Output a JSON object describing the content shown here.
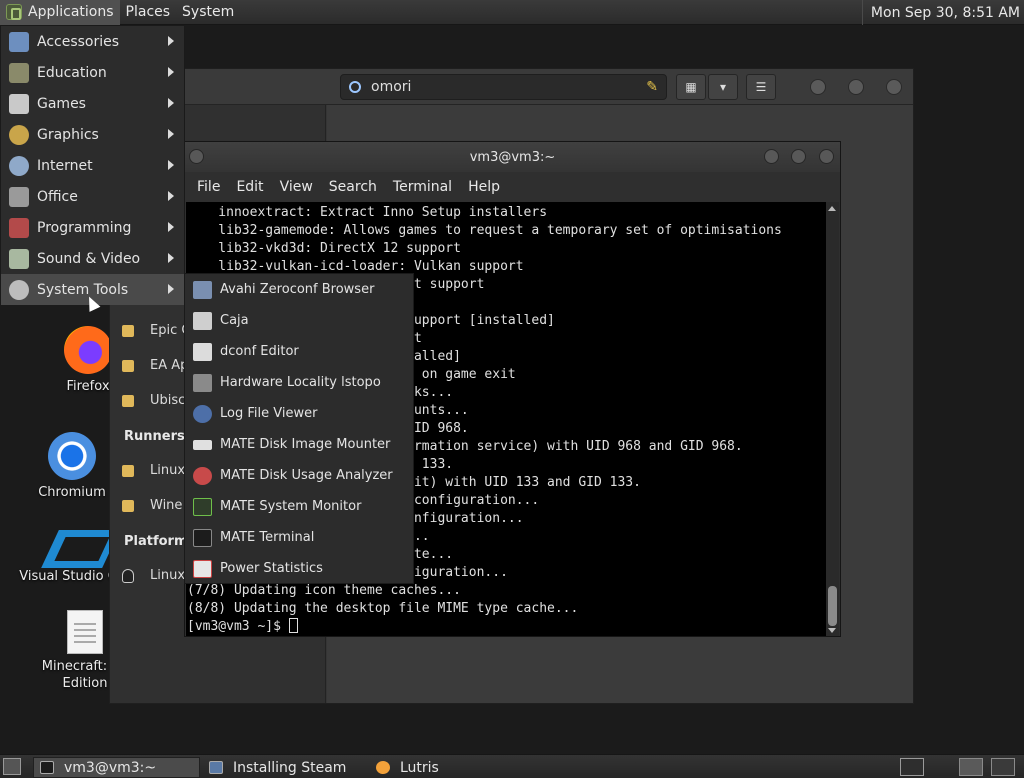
{
  "top_panel": {
    "menus": [
      "Applications",
      "Places",
      "System"
    ],
    "clock": "Mon Sep 30,  8:51 AM"
  },
  "desktop_icons": [
    {
      "label": "Firefox",
      "icon": "firefox-icon"
    },
    {
      "label": "Chromium",
      "icon": "chromium-icon"
    },
    {
      "label": "Visual Studio Co",
      "icon": "vscode-icon"
    },
    {
      "label": "Minecraft: Be",
      "label2": "Edition",
      "icon": "document-icon"
    }
  ],
  "app_menu": {
    "items": [
      {
        "label": "Accessories",
        "icon": "accessories-icon"
      },
      {
        "label": "Education",
        "icon": "education-icon"
      },
      {
        "label": "Games",
        "icon": "games-icon"
      },
      {
        "label": "Graphics",
        "icon": "graphics-icon"
      },
      {
        "label": "Internet",
        "icon": "internet-icon"
      },
      {
        "label": "Office",
        "icon": "office-icon"
      },
      {
        "label": "Programming",
        "icon": "programming-icon"
      },
      {
        "label": "Sound & Video",
        "icon": "sound-video-icon"
      },
      {
        "label": "System Tools",
        "icon": "system-tools-icon"
      }
    ],
    "active_index": 8
  },
  "system_tools_submenu": {
    "items": [
      {
        "label": "Avahi Zeroconf Browser",
        "icon": "avahi-icon"
      },
      {
        "label": "Caja",
        "icon": "caja-icon"
      },
      {
        "label": "dconf Editor",
        "icon": "dconf-icon"
      },
      {
        "label": "Hardware Locality lstopo",
        "icon": "lstopo-icon"
      },
      {
        "label": "Log File Viewer",
        "icon": "log-viewer-icon"
      },
      {
        "label": "MATE Disk Image Mounter",
        "icon": "disk-mounter-icon"
      },
      {
        "label": "MATE Disk Usage Analyzer",
        "icon": "disk-usage-icon"
      },
      {
        "label": "MATE System Monitor",
        "icon": "system-monitor-icon"
      },
      {
        "label": "MATE Terminal",
        "icon": "terminal-icon"
      },
      {
        "label": "Power Statistics",
        "icon": "power-stats-icon"
      }
    ]
  },
  "lutris": {
    "search_value": "omori",
    "library_rows": [
      {
        "label": "Epic G"
      },
      {
        "label": "EA Ap"
      },
      {
        "label": "Ubisc"
      }
    ],
    "runners_heading": "Runners",
    "runner_rows": [
      {
        "label": "Linux"
      },
      {
        "label": "Wine"
      }
    ],
    "platforms_heading": "Platforms",
    "platform_rows": [
      {
        "label": "Linux"
      }
    ]
  },
  "terminal": {
    "title": "vm3@vm3:~",
    "menu": [
      "File",
      "Edit",
      "View",
      "Search",
      "Terminal",
      "Help"
    ],
    "lines": [
      "    innoextract: Extract Inno Setup installers",
      "    lib32-gamemode: Allows games to request a temporary set of optimisations",
      "    lib32-vkd3d: DirectX 12 support",
      "    lib32-vulkan-icd-loader: Vulkan support",
      "                           net support",
      "                        :",
      "                          n support [installed]",
      "                          port",
      "                          nstalled]",
      "                           na on game exit",
      "                          hooks...",
      "                          ccounts...",
      "                          n GID 968.",
      "                          nformation service) with UID 968 and GID 968.",
      "                          GID 133.",
      "                          meKit) with UID 133 and GID 133.",
      "                          er configuration...",
      "                           configuration...",
      "                          es...",
      "                          pdate...",
      "                          onfiguration...",
      "(7/8) Updating icon theme caches...",
      "(8/8) Updating the desktop file MIME type cache..."
    ],
    "prompt": "[vm3@vm3 ~]$ "
  },
  "taskbar": {
    "tasks": [
      {
        "label": "vm3@vm3:~",
        "icon": "terminal-icon",
        "active": true
      },
      {
        "label": "Installing Steam",
        "icon": "window-icon",
        "active": false
      },
      {
        "label": "Lutris",
        "icon": "lutris-icon",
        "active": false
      }
    ],
    "workspaces": 2
  },
  "colors": {
    "panel": "#2b2b2b",
    "menu_bg": "#2c2c2c",
    "menu_active": "#4a4a4a",
    "terminal_bg": "#000000",
    "terminal_fg": "#e0e0e0"
  }
}
